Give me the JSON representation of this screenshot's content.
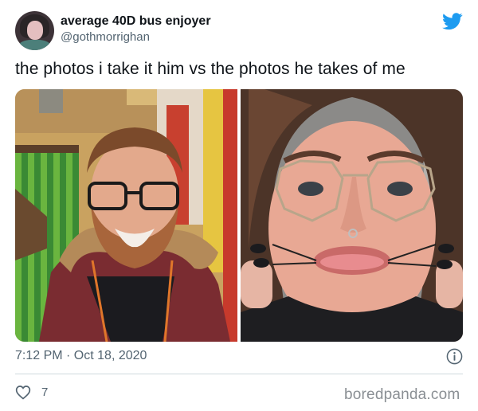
{
  "tweet": {
    "display_name": "average 40D bus enjoyer",
    "handle": "@gothmorrighan",
    "text": "the photos i take it him vs the photos he takes of me",
    "timestamp": "7:12 PM · Oct 18, 2020",
    "like_count": "7"
  },
  "watermark": "boredpanda.com",
  "colors": {
    "twitter_blue": "#1d9bf0",
    "secondary_text": "#536471",
    "divider": "#cfd9de"
  },
  "icons": {
    "brand": "twitter-bird-icon",
    "info": "info-icon",
    "like": "heart-icon"
  }
}
